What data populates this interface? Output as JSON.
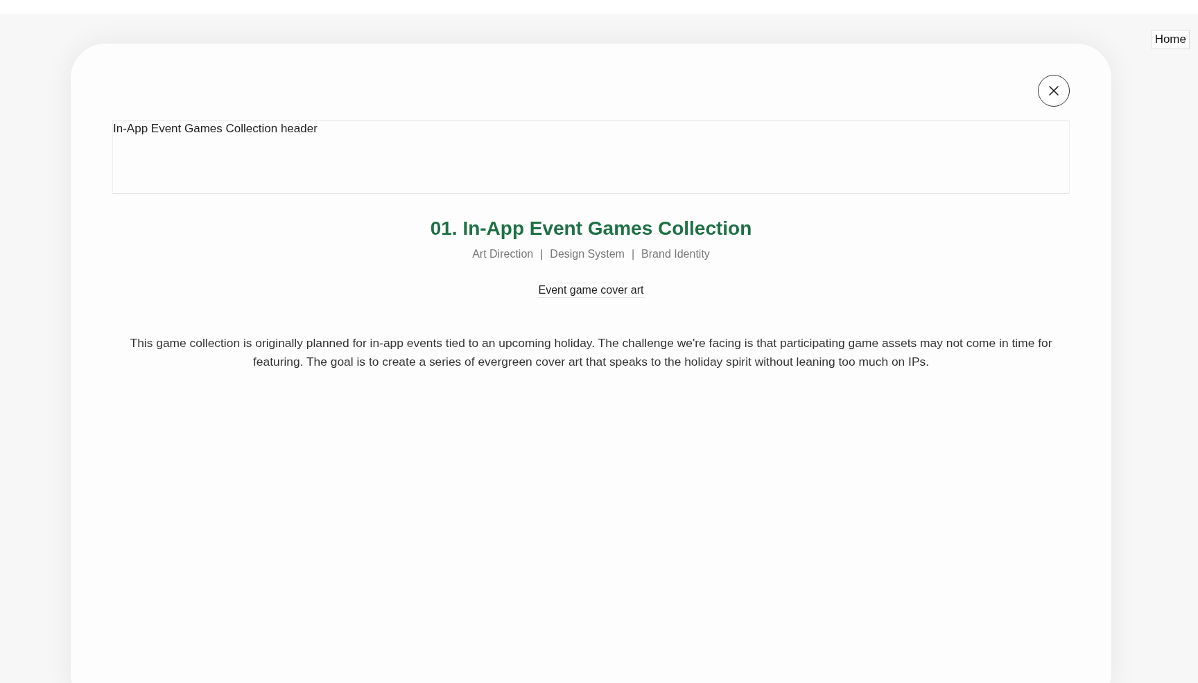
{
  "nav": {
    "home": "Home"
  },
  "modal": {
    "header_image_alt": "In-App Event Games Collection header",
    "title": "01. In-App Event Games Collection",
    "tags": [
      "Art Direction",
      "Design System",
      "Brand Identity"
    ],
    "tag_separator": "|",
    "cover_image_alt": "Event game cover art",
    "description": "This game collection is originally planned for in-app events tied to an upcoming holiday. The challenge we're facing is that participating game assets may not come in time for featuring. The goal is to create a series of evergreen cover art that speaks to the holiday spirit without leaning too much on IPs."
  }
}
